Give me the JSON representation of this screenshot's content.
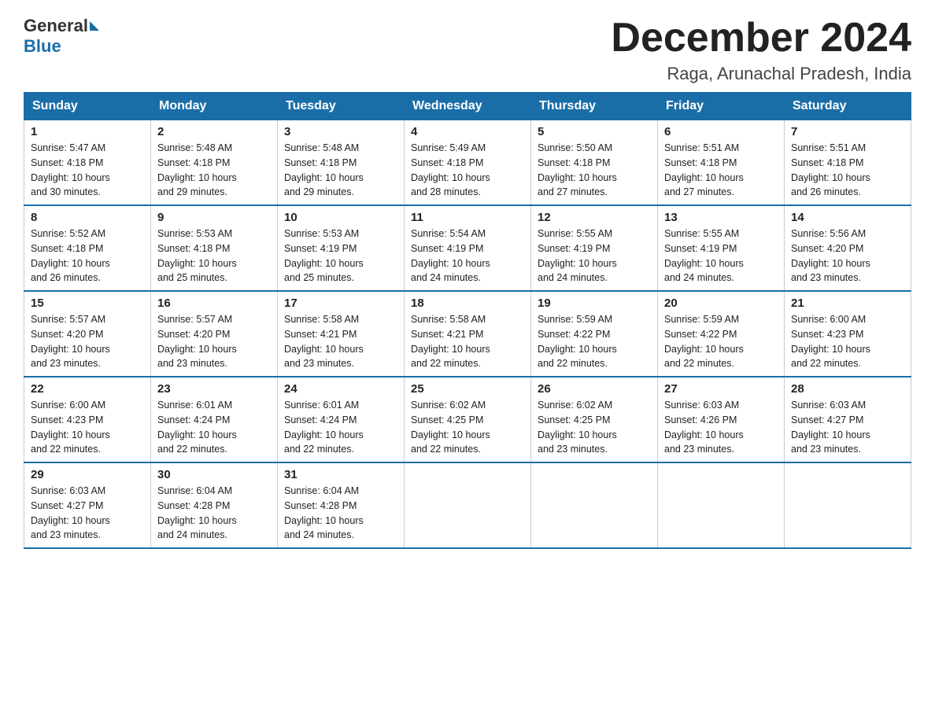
{
  "logo": {
    "general": "General",
    "blue": "Blue"
  },
  "header": {
    "month_year": "December 2024",
    "location": "Raga, Arunachal Pradesh, India"
  },
  "days_of_week": [
    "Sunday",
    "Monday",
    "Tuesday",
    "Wednesday",
    "Thursday",
    "Friday",
    "Saturday"
  ],
  "weeks": [
    [
      {
        "day": "1",
        "sunrise": "5:47 AM",
        "sunset": "4:18 PM",
        "daylight": "10 hours and 30 minutes."
      },
      {
        "day": "2",
        "sunrise": "5:48 AM",
        "sunset": "4:18 PM",
        "daylight": "10 hours and 29 minutes."
      },
      {
        "day": "3",
        "sunrise": "5:48 AM",
        "sunset": "4:18 PM",
        "daylight": "10 hours and 29 minutes."
      },
      {
        "day": "4",
        "sunrise": "5:49 AM",
        "sunset": "4:18 PM",
        "daylight": "10 hours and 28 minutes."
      },
      {
        "day": "5",
        "sunrise": "5:50 AM",
        "sunset": "4:18 PM",
        "daylight": "10 hours and 27 minutes."
      },
      {
        "day": "6",
        "sunrise": "5:51 AM",
        "sunset": "4:18 PM",
        "daylight": "10 hours and 27 minutes."
      },
      {
        "day": "7",
        "sunrise": "5:51 AM",
        "sunset": "4:18 PM",
        "daylight": "10 hours and 26 minutes."
      }
    ],
    [
      {
        "day": "8",
        "sunrise": "5:52 AM",
        "sunset": "4:18 PM",
        "daylight": "10 hours and 26 minutes."
      },
      {
        "day": "9",
        "sunrise": "5:53 AM",
        "sunset": "4:18 PM",
        "daylight": "10 hours and 25 minutes."
      },
      {
        "day": "10",
        "sunrise": "5:53 AM",
        "sunset": "4:19 PM",
        "daylight": "10 hours and 25 minutes."
      },
      {
        "day": "11",
        "sunrise": "5:54 AM",
        "sunset": "4:19 PM",
        "daylight": "10 hours and 24 minutes."
      },
      {
        "day": "12",
        "sunrise": "5:55 AM",
        "sunset": "4:19 PM",
        "daylight": "10 hours and 24 minutes."
      },
      {
        "day": "13",
        "sunrise": "5:55 AM",
        "sunset": "4:19 PM",
        "daylight": "10 hours and 24 minutes."
      },
      {
        "day": "14",
        "sunrise": "5:56 AM",
        "sunset": "4:20 PM",
        "daylight": "10 hours and 23 minutes."
      }
    ],
    [
      {
        "day": "15",
        "sunrise": "5:57 AM",
        "sunset": "4:20 PM",
        "daylight": "10 hours and 23 minutes."
      },
      {
        "day": "16",
        "sunrise": "5:57 AM",
        "sunset": "4:20 PM",
        "daylight": "10 hours and 23 minutes."
      },
      {
        "day": "17",
        "sunrise": "5:58 AM",
        "sunset": "4:21 PM",
        "daylight": "10 hours and 23 minutes."
      },
      {
        "day": "18",
        "sunrise": "5:58 AM",
        "sunset": "4:21 PM",
        "daylight": "10 hours and 22 minutes."
      },
      {
        "day": "19",
        "sunrise": "5:59 AM",
        "sunset": "4:22 PM",
        "daylight": "10 hours and 22 minutes."
      },
      {
        "day": "20",
        "sunrise": "5:59 AM",
        "sunset": "4:22 PM",
        "daylight": "10 hours and 22 minutes."
      },
      {
        "day": "21",
        "sunrise": "6:00 AM",
        "sunset": "4:23 PM",
        "daylight": "10 hours and 22 minutes."
      }
    ],
    [
      {
        "day": "22",
        "sunrise": "6:00 AM",
        "sunset": "4:23 PM",
        "daylight": "10 hours and 22 minutes."
      },
      {
        "day": "23",
        "sunrise": "6:01 AM",
        "sunset": "4:24 PM",
        "daylight": "10 hours and 22 minutes."
      },
      {
        "day": "24",
        "sunrise": "6:01 AM",
        "sunset": "4:24 PM",
        "daylight": "10 hours and 22 minutes."
      },
      {
        "day": "25",
        "sunrise": "6:02 AM",
        "sunset": "4:25 PM",
        "daylight": "10 hours and 22 minutes."
      },
      {
        "day": "26",
        "sunrise": "6:02 AM",
        "sunset": "4:25 PM",
        "daylight": "10 hours and 23 minutes."
      },
      {
        "day": "27",
        "sunrise": "6:03 AM",
        "sunset": "4:26 PM",
        "daylight": "10 hours and 23 minutes."
      },
      {
        "day": "28",
        "sunrise": "6:03 AM",
        "sunset": "4:27 PM",
        "daylight": "10 hours and 23 minutes."
      }
    ],
    [
      {
        "day": "29",
        "sunrise": "6:03 AM",
        "sunset": "4:27 PM",
        "daylight": "10 hours and 23 minutes."
      },
      {
        "day": "30",
        "sunrise": "6:04 AM",
        "sunset": "4:28 PM",
        "daylight": "10 hours and 24 minutes."
      },
      {
        "day": "31",
        "sunrise": "6:04 AM",
        "sunset": "4:28 PM",
        "daylight": "10 hours and 24 minutes."
      },
      null,
      null,
      null,
      null
    ]
  ],
  "labels": {
    "sunrise": "Sunrise: ",
    "sunset": "Sunset: ",
    "daylight": "Daylight: "
  }
}
